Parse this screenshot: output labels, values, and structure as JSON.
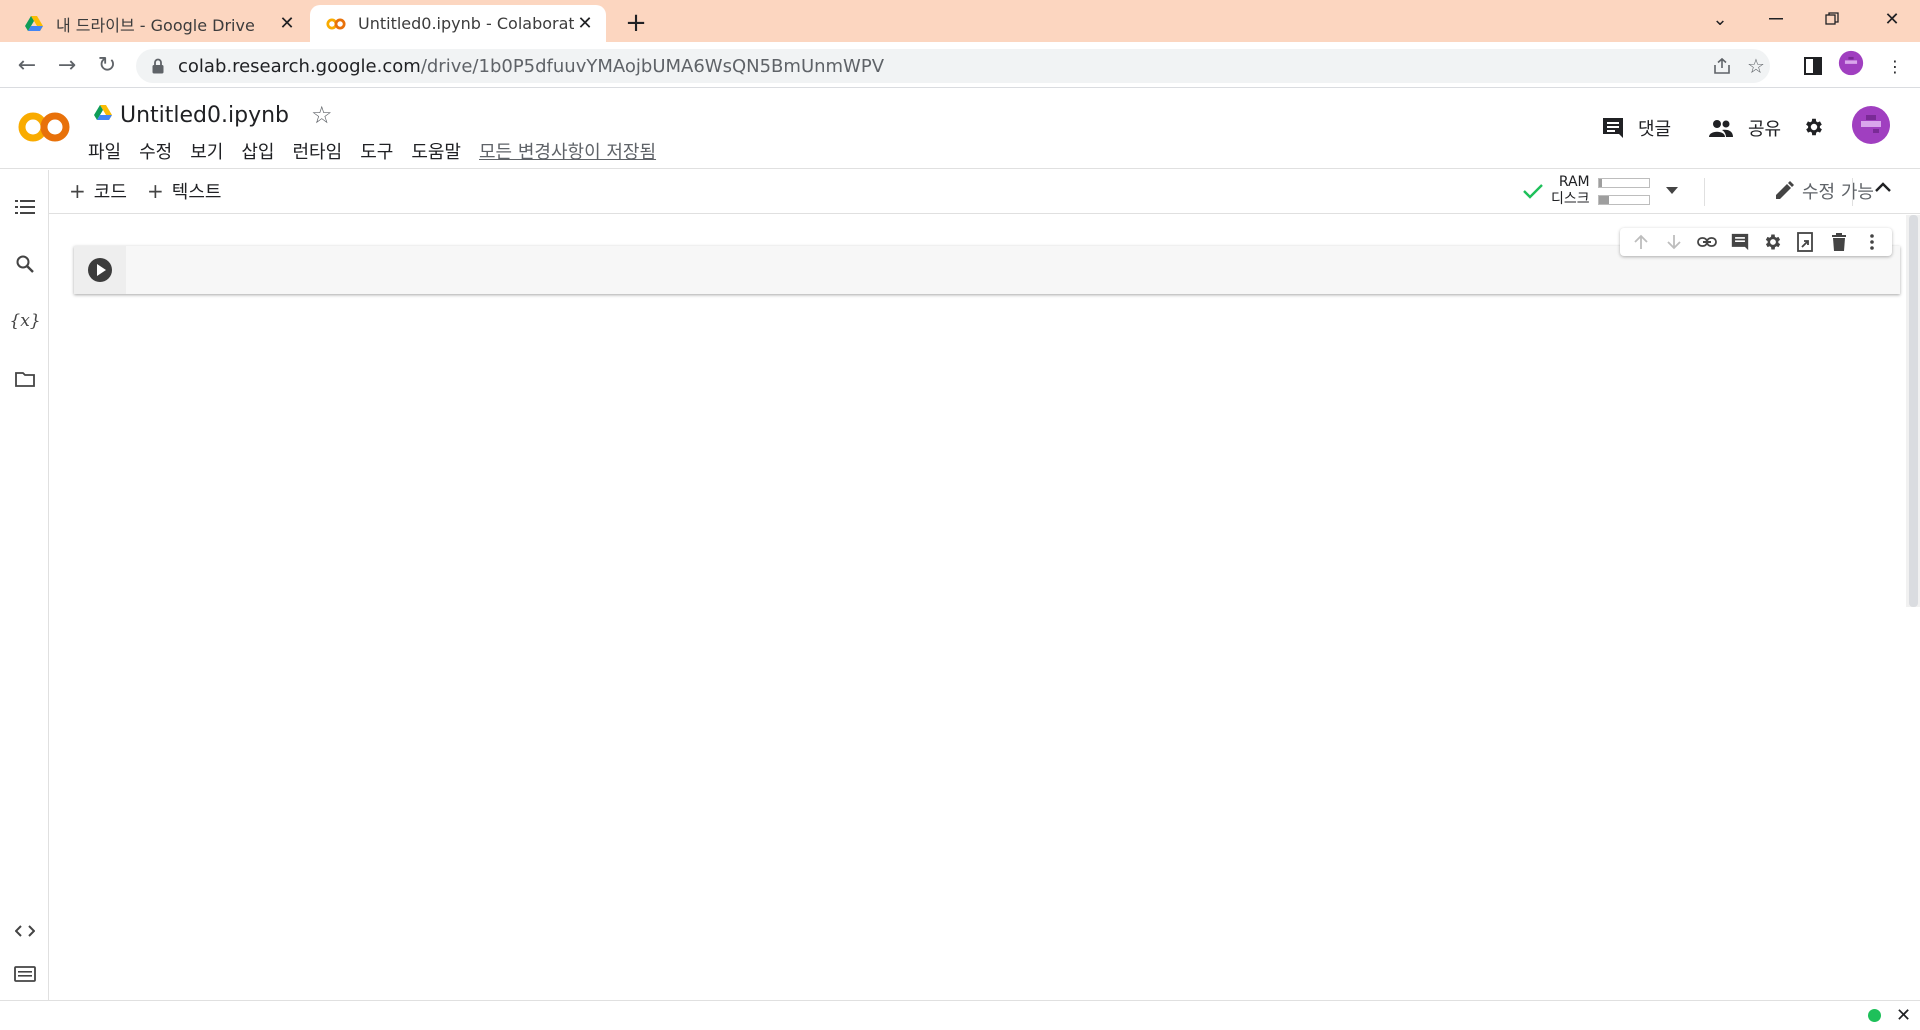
{
  "browser": {
    "tabs": [
      {
        "title": "내 드라이브 - Google Drive",
        "icon": "google-drive-icon",
        "active": false
      },
      {
        "title": "Untitled0.ipynb - Colaboratory",
        "icon": "colab-icon",
        "active": true
      }
    ],
    "url_host": "colab.research.google.com",
    "url_path": "/drive/1b0P5dfuuvYMAojbUMA6WsQN5BmUnmWPV"
  },
  "notebook": {
    "title": "Untitled0.ipynb",
    "menu": [
      "파일",
      "수정",
      "보기",
      "삽입",
      "런타임",
      "도구",
      "도움말"
    ],
    "saved_status": "모든 변경사항이 저장됨",
    "comment_label": "댓글",
    "share_label": "공유"
  },
  "toolbar": {
    "add_code": "코드",
    "add_text": "텍스트",
    "ram_label": "RAM",
    "disk_label": "디스크",
    "edit_label": "수정 가능"
  },
  "colors": {
    "colab_orange": "#F9AB00",
    "colab_dark_orange": "#E8710A",
    "tabstrip": "#FCD6C0",
    "connected_green": "#1EC05A",
    "avatar_purple": "#A03FC0"
  }
}
